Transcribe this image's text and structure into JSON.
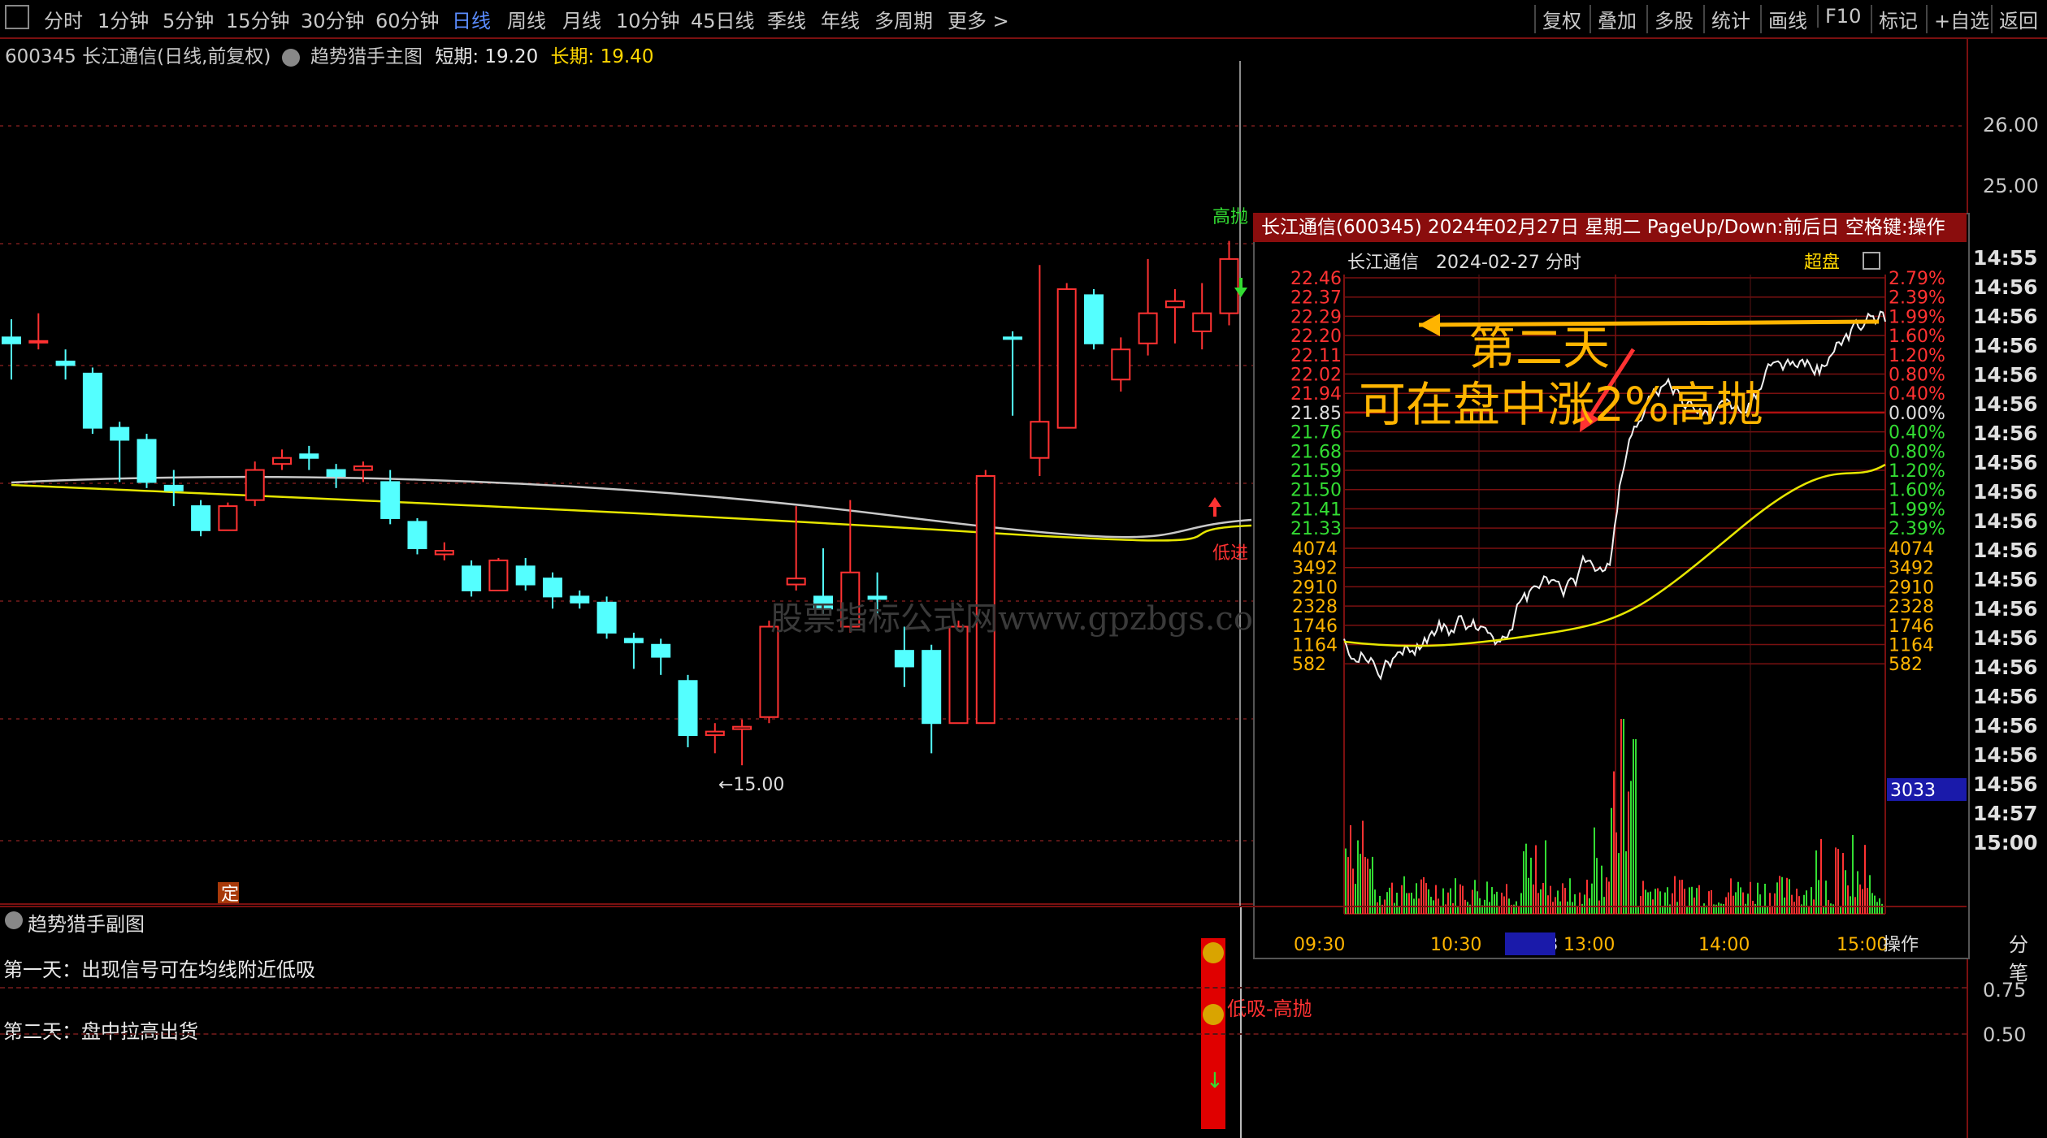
{
  "toolbar": {
    "periods": [
      "分时",
      "1分钟",
      "5分钟",
      "15分钟",
      "30分钟",
      "60分钟",
      "日线",
      "周线",
      "月线",
      "10分钟",
      "45日线",
      "季线",
      "年线",
      "多周期",
      "更多 >"
    ],
    "active_period": "日线",
    "right_buttons": [
      "复权",
      "叠加",
      "多股",
      "统计",
      "画线",
      "F10",
      "标记",
      "+自选",
      "返回"
    ]
  },
  "info_line": {
    "stock": "600345 长江通信(日线,前复权)",
    "indicator": "趋势猎手主图",
    "short_label": "短期:",
    "short_value": "19.20",
    "long_label": "长期:",
    "long_value": "19.40"
  },
  "main_axis": {
    "labels": [
      "26.00",
      "25.00"
    ]
  },
  "main_chart": {
    "low_marker": "←15.00",
    "high_signal": "高抛",
    "low_signal": "低进",
    "fixed_tag": "定",
    "watermark": "股票指标公式网www.gpzbgs.com"
  },
  "popup": {
    "title": "长江通信(600345) 2024年02月27日 星期二 PageUp/Down:前后日 空格键:操作",
    "sub_name": "长江通信",
    "sub_date": "2024-02-27 分时",
    "super_label": "超盘",
    "price_labels": [
      "22.46",
      "22.37",
      "22.29",
      "22.20",
      "22.11",
      "22.02",
      "21.94",
      "21.85",
      "21.76",
      "21.68",
      "21.59",
      "21.50",
      "21.41",
      "21.33"
    ],
    "pct_labels": [
      "2.79%",
      "2.39%",
      "1.99%",
      "1.60%",
      "1.20%",
      "0.80%",
      "0.40%",
      "0.00%",
      "0.40%",
      "0.80%",
      "1.20%",
      "1.60%",
      "1.99%",
      "2.39%"
    ],
    "vol_labels": [
      "4074",
      "3492",
      "2910",
      "2328",
      "1746",
      "1164",
      "582"
    ],
    "vol_labels_right": [
      "4074",
      "3492",
      "2910",
      "2328",
      "1746",
      "1164",
      "582"
    ],
    "vol_current": "3033",
    "time_labels": [
      "09:30",
      "10:30",
      "11:03",
      "13:00",
      "14:00",
      "15:00"
    ],
    "operate": "操作",
    "annotation_line1": "第二天",
    "annotation_line2": "可在盘中涨2%高抛"
  },
  "time_list": [
    "14:55",
    "14:56",
    "14:56",
    "14:56",
    "14:56",
    "14:56",
    "14:56",
    "14:56",
    "14:56",
    "14:56",
    "14:56",
    "14:56",
    "14:56",
    "14:56",
    "14:56",
    "14:56",
    "14:56",
    "14:56",
    "14:56",
    "14:57",
    "15:00"
  ],
  "fen_bi": "分笔",
  "sub_panel": {
    "title": "趋势猎手副图",
    "note1": "第一天：出现信号可在均线附近低吸",
    "note2": "第二天：盘中拉高出货",
    "signal_label": "低吸-高抛",
    "axis": [
      "0.75",
      "0.50"
    ]
  },
  "colors": {
    "up": "#ff3232",
    "down": "#54ffff",
    "accent": "#8a0d0d",
    "ma_white": "#c8c8c8",
    "ma_yellow": "#e6e600",
    "orange": "#ffb400"
  },
  "candles": [
    {
      "o": 17.65,
      "c": 17.6,
      "h": 17.8,
      "l": 17.3
    },
    {
      "o": 17.62,
      "c": 17.62,
      "h": 17.85,
      "l": 17.55
    },
    {
      "o": 17.45,
      "c": 17.42,
      "h": 17.55,
      "l": 17.3
    },
    {
      "o": 17.35,
      "c": 16.9,
      "h": 17.4,
      "l": 16.85
    },
    {
      "o": 16.9,
      "c": 16.8,
      "h": 16.95,
      "l": 16.45
    },
    {
      "o": 16.8,
      "c": 16.45,
      "h": 16.85,
      "l": 16.4
    },
    {
      "o": 16.42,
      "c": 16.38,
      "h": 16.55,
      "l": 16.25
    },
    {
      "o": 16.25,
      "c": 16.05,
      "h": 16.3,
      "l": 16.0
    },
    {
      "o": 16.05,
      "c": 16.25,
      "h": 16.28,
      "l": 16.05
    },
    {
      "o": 16.3,
      "c": 16.55,
      "h": 16.62,
      "l": 16.25
    },
    {
      "o": 16.6,
      "c": 16.65,
      "h": 16.72,
      "l": 16.55
    },
    {
      "o": 16.68,
      "c": 16.65,
      "h": 16.75,
      "l": 16.55
    },
    {
      "o": 16.55,
      "c": 16.5,
      "h": 16.6,
      "l": 16.4
    },
    {
      "o": 16.55,
      "c": 16.58,
      "h": 16.62,
      "l": 16.45
    },
    {
      "o": 16.45,
      "c": 16.15,
      "h": 16.55,
      "l": 16.1
    },
    {
      "o": 16.12,
      "c": 15.9,
      "h": 16.15,
      "l": 15.85
    },
    {
      "o": 15.85,
      "c": 15.88,
      "h": 15.95,
      "l": 15.8
    },
    {
      "o": 15.75,
      "c": 15.55,
      "h": 15.8,
      "l": 15.5
    },
    {
      "o": 15.55,
      "c": 15.8,
      "h": 15.82,
      "l": 15.55
    },
    {
      "o": 15.75,
      "c": 15.6,
      "h": 15.82,
      "l": 15.55
    },
    {
      "o": 15.65,
      "c": 15.5,
      "h": 15.7,
      "l": 15.4
    },
    {
      "o": 15.5,
      "c": 15.45,
      "h": 15.55,
      "l": 15.4
    },
    {
      "o": 15.45,
      "c": 15.2,
      "h": 15.5,
      "l": 15.15
    },
    {
      "o": 15.15,
      "c": 15.12,
      "h": 15.2,
      "l": 14.9
    },
    {
      "o": 15.1,
      "c": 15.0,
      "h": 15.15,
      "l": 14.85
    },
    {
      "o": 14.8,
      "c": 14.35,
      "h": 14.85,
      "l": 14.25
    },
    {
      "o": 14.35,
      "c": 14.38,
      "h": 14.45,
      "l": 14.2
    },
    {
      "o": 14.4,
      "c": 14.42,
      "h": 14.48,
      "l": 14.1
    },
    {
      "o": 14.5,
      "c": 15.25,
      "h": 15.3,
      "l": 14.45
    },
    {
      "o": 15.6,
      "c": 15.65,
      "h": 16.25,
      "l": 15.55
    },
    {
      "o": 15.5,
      "c": 15.4,
      "h": 15.9,
      "l": 15.35
    },
    {
      "o": 15.25,
      "c": 15.7,
      "h": 16.3,
      "l": 15.2
    },
    {
      "o": 15.5,
      "c": 15.48,
      "h": 15.7,
      "l": 15.35
    },
    {
      "o": 15.05,
      "c": 14.92,
      "h": 15.25,
      "l": 14.75
    },
    {
      "o": 15.05,
      "c": 14.45,
      "h": 15.1,
      "l": 14.2
    },
    {
      "o": 14.45,
      "c": 15.25,
      "h": 15.3,
      "l": 14.45
    },
    {
      "o": 14.45,
      "c": 16.5,
      "h": 16.55,
      "l": 14.45
    },
    {
      "o": 17.65,
      "c": 17.64,
      "h": 17.7,
      "l": 17.0
    },
    {
      "o": 16.65,
      "c": 16.95,
      "h": 18.25,
      "l": 16.5
    },
    {
      "o": 16.9,
      "c": 18.05,
      "h": 18.1,
      "l": 16.9
    },
    {
      "o": 18.0,
      "c": 17.6,
      "h": 18.05,
      "l": 17.55
    },
    {
      "o": 17.3,
      "c": 17.55,
      "h": 17.65,
      "l": 17.2
    },
    {
      "o": 17.6,
      "c": 17.85,
      "h": 18.3,
      "l": 17.5
    },
    {
      "o": 17.9,
      "c": 17.95,
      "h": 18.05,
      "l": 17.6
    },
    {
      "o": 17.7,
      "c": 17.85,
      "h": 18.1,
      "l": 17.55
    },
    {
      "o": 17.85,
      "c": 18.3,
      "h": 18.45,
      "l": 17.75
    }
  ]
}
